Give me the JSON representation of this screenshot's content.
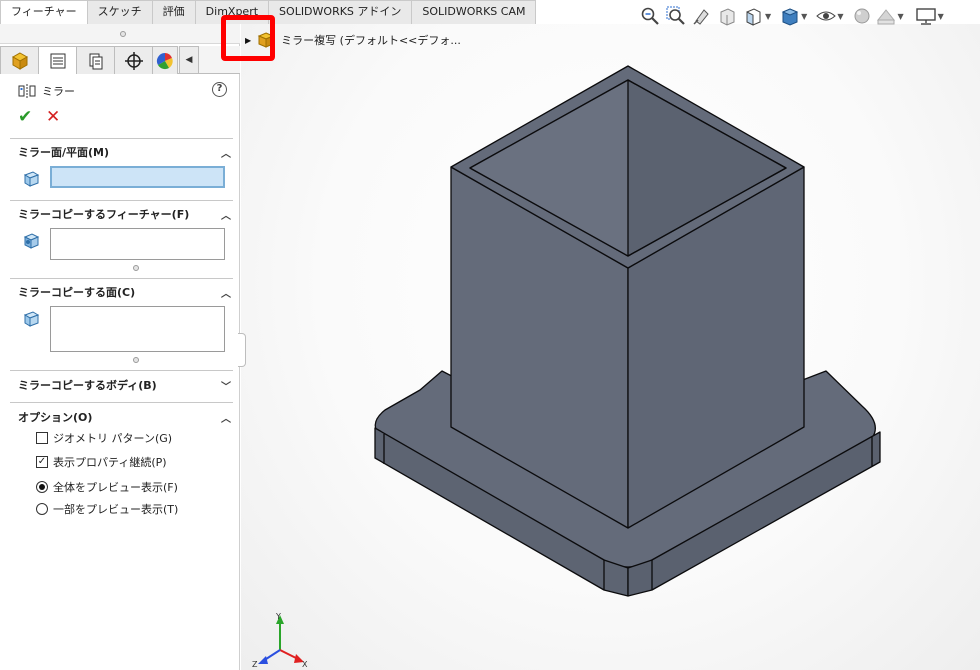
{
  "tabs": [
    "フィーチャー",
    "スケッチ",
    "評価",
    "DimXpert",
    "SOLIDWORKS アドイン",
    "SOLIDWORKS CAM"
  ],
  "property_manager": {
    "title": "ミラー",
    "help_symbol": "?",
    "ok_symbol": "✔",
    "cancel_symbol": "✕",
    "groups": {
      "mirror_plane": {
        "label": "ミラー面/平面(M)",
        "value": ""
      },
      "features": {
        "label": "ミラーコピーするフィーチャー(F)",
        "value": ""
      },
      "faces": {
        "label": "ミラーコピーする面(C)",
        "value": ""
      },
      "bodies": {
        "label": "ミラーコピーするボディ(B)"
      },
      "options": {
        "label": "オプション(O)",
        "geometry_pattern": "ジオメトリ パターン(G)",
        "geometry_pattern_checked": false,
        "propagate_visual": "表示プロパティ継続(P)",
        "propagate_visual_checked": true,
        "full_preview": "全体をプレビュー表示(F)",
        "partial_preview": "一部をプレビュー表示(T)",
        "selected_preview": "full"
      }
    }
  },
  "tree": {
    "label": "ミラー複写 (デフォルト<<デフォ..."
  },
  "triad": {
    "y": "Y",
    "x": "X",
    "z": "Z"
  },
  "colors": {
    "model": "#646b7a",
    "model_edge": "#0b0b0d",
    "highlight": "#ff0000",
    "selection": "#cde4f7"
  },
  "icons": [
    "zoom-to-fit-icon",
    "zoom-area-icon",
    "previous-view-icon",
    "section-view-icon",
    "view-orientation-icon",
    "display-style-icon",
    "hide-show-icon",
    "appearance-icon",
    "scene-icon",
    "monitor-icon"
  ]
}
